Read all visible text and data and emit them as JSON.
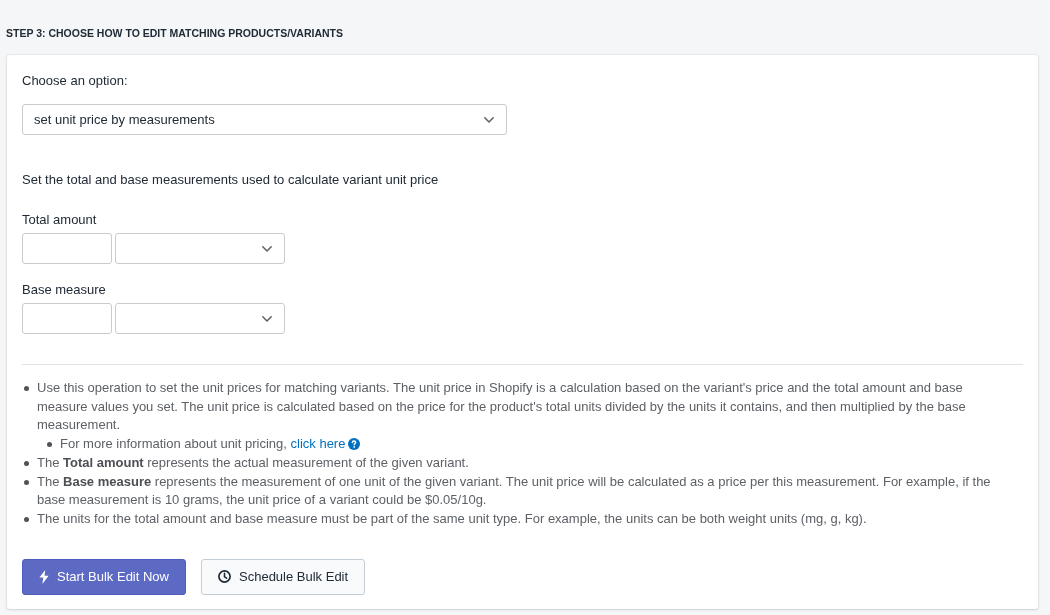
{
  "step_title": "STEP 3: CHOOSE HOW TO EDIT MATCHING PRODUCTS/VARIANTS",
  "option": {
    "label": "Choose an option:",
    "value": "set unit price by measurements"
  },
  "measurements": {
    "intro": "Set the total and base measurements used to calculate variant unit price",
    "fields": [
      {
        "label": "Total amount"
      },
      {
        "label": "Base measure"
      }
    ]
  },
  "notes": [
    {
      "text": "Use this operation to set the unit prices for matching variants. The unit price in Shopify is a calculation based on the variant's price and the total amount and base measure values you set. The unit price is calculated based on the price for the product's total units divided by the units it contains, and then multiplied by the base measurement.",
      "children": [
        {
          "text": "For more information about unit pricing,",
          "link": "click here"
        }
      ]
    },
    {
      "text": "The **Total amount** represents the actual measurement of the given variant."
    },
    {
      "text": "The **Base measure** represents the measurement of one unit of the given variant. The unit price will be calculated as a price per this measurement. For example, if the base measurement is 10 grams, the unit price of a variant could be $0.05/10g."
    },
    {
      "text": "The units for the total amount and base measure must be part of the same unit type. For example, the units can be both weight units (mg, g, kg)."
    }
  ],
  "buttons": [
    {
      "label": "Start Bulk Edit Now",
      "kind": "primary"
    },
    {
      "label": "Schedule Bulk Edit",
      "kind": "secondary"
    }
  ]
}
